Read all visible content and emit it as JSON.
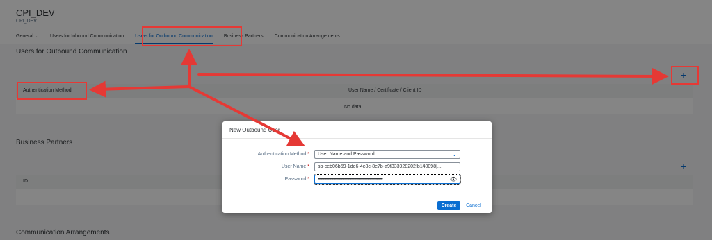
{
  "header": {
    "title": "CPI_DEV",
    "subtitle": "CPI_DEV",
    "tabs": [
      {
        "label": "General"
      },
      {
        "label": "Users for Inbound Communication"
      },
      {
        "label": "Users for Outbound Communication"
      },
      {
        "label": "Business Partners"
      },
      {
        "label": "Communication Arrangements"
      }
    ]
  },
  "outbound": {
    "title": "Users for Outbound Communication",
    "add_label": "+",
    "columns": [
      "Authentication Method",
      "User Name / Certificate / Client ID"
    ],
    "empty_text": "No data"
  },
  "business_partners": {
    "title": "Business Partners",
    "add_label": "+",
    "columns": [
      "ID"
    ]
  },
  "arrangements": {
    "title": "Communication Arrangements"
  },
  "dialog": {
    "title": "New Outbound User",
    "auth_label": "Authentication Method:",
    "auth_value": "User Name and Password",
    "user_label": "User Name:",
    "user_value": "sb-ceb06b59-1de6-4e8c-8e7b-a9f333928202!b140098|...",
    "password_label": "Password:",
    "password_value": "••••••••••••••••••••••••••••••••••••••••••••••••••••••••••••••••",
    "create_label": "Create",
    "cancel_label": "Cancel",
    "required_mark": "*"
  },
  "icons": {
    "dropdown": "chevron-down-icon",
    "show_password": "eye-icon",
    "add": "plus-icon"
  },
  "colors": {
    "accent": "#0a6ed1",
    "annotation": "#e53935",
    "required": "#bb0000"
  }
}
